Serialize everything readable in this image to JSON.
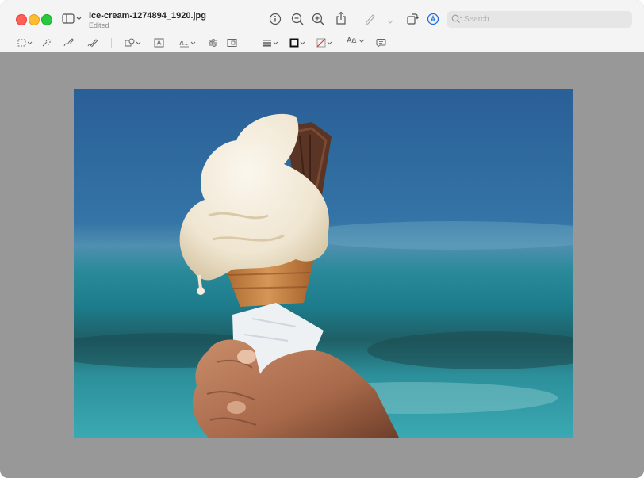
{
  "window": {
    "file_name": "ice-cream-1274894_1920.jpg",
    "status": "Edited"
  },
  "search": {
    "placeholder": "Search"
  },
  "toolbar": {
    "text_style_label": "Aa"
  },
  "icons": {
    "sidebar_toggle": "sidebar-icon",
    "info": "info-icon",
    "zoom_out": "zoom-out-icon",
    "zoom_in": "zoom-in-icon",
    "share": "share-icon",
    "markup": "pen-icon",
    "rotate": "rotate-icon",
    "markup_toolbar": "markup-circle-icon"
  },
  "image": {
    "description_colors": {
      "sky": "#2f6aa0",
      "sea": "#2a8fa0",
      "ice_cream": "#f2ead8",
      "cone": "#c98a4a",
      "flake": "#5a3424"
    }
  },
  "colors": {
    "accent": "#1f6fd8",
    "canvas_background": "#989898"
  }
}
